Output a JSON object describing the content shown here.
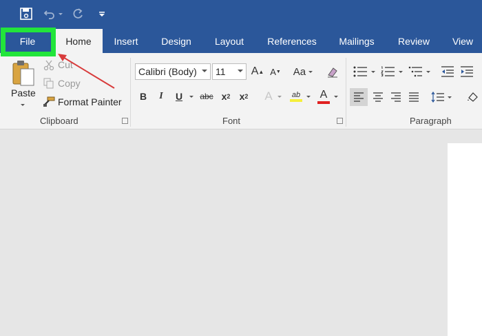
{
  "colors": {
    "title_bar": "#2b579a",
    "highlight": "#22e53b",
    "arrow": "#d83b3b"
  },
  "quick_access": {
    "icons": [
      "save-icon",
      "undo-icon",
      "redo-icon",
      "customize-qat-icon"
    ]
  },
  "tabs": [
    {
      "label": "File",
      "active": false
    },
    {
      "label": "Home",
      "active": true
    },
    {
      "label": "Insert",
      "active": false
    },
    {
      "label": "Design",
      "active": false
    },
    {
      "label": "Layout",
      "active": false
    },
    {
      "label": "References",
      "active": false
    },
    {
      "label": "Mailings",
      "active": false
    },
    {
      "label": "Review",
      "active": false
    },
    {
      "label": "View",
      "active": false
    }
  ],
  "clipboard": {
    "paste_label": "Paste",
    "cut_label": "Cut",
    "copy_label": "Copy",
    "format_painter_label": "Format Painter",
    "group_label": "Clipboard"
  },
  "font": {
    "font_name": "Calibri (Body)",
    "font_size": "11",
    "grow_label": "A",
    "shrink_label": "A",
    "case_label": "Aa",
    "bold_label": "B",
    "italic_label": "I",
    "underline_label": "U",
    "strike_label": "abc",
    "sub_label": "x",
    "sub_index": "2",
    "super_label": "x",
    "super_index": "2",
    "effects_label": "A",
    "highlight_label": "ab",
    "color_label": "A",
    "group_label": "Font"
  },
  "paragraph": {
    "group_label": "Paragraph"
  }
}
